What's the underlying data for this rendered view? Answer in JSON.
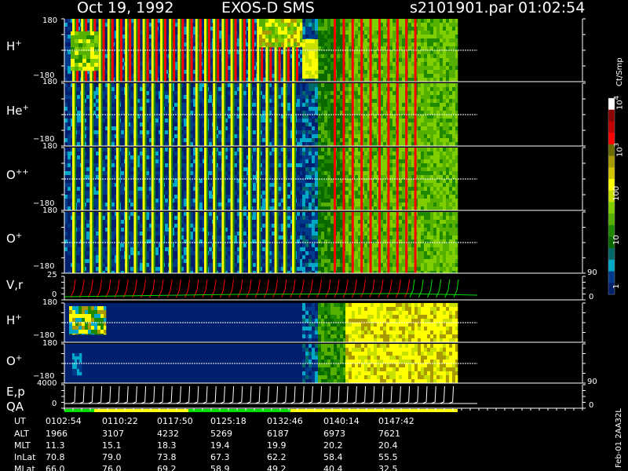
{
  "header": {
    "date": "Oct 19, 1992",
    "instrument": "EXOS-D SMS",
    "file": "s2101901.par",
    "time": "01:02:54"
  },
  "panels": [
    {
      "id": "hplus",
      "label": "H",
      "sup": "+",
      "top_tick": "180",
      "bottom_tick": "−180"
    },
    {
      "id": "heplus",
      "label": "He",
      "sup": "+",
      "top_tick": "180",
      "bottom_tick": "−180"
    },
    {
      "id": "oplusplus",
      "label": "O",
      "sup": "++",
      "top_tick": "180",
      "bottom_tick": "−180"
    },
    {
      "id": "oplus",
      "label": "O",
      "sup": "+",
      "top_tick": "180",
      "bottom_tick": "−180"
    },
    {
      "id": "vr",
      "label": "V,r",
      "sup": "",
      "top_tick": "25",
      "bottom_tick": "0",
      "right_top": "90",
      "right_bottom": "0"
    },
    {
      "id": "hplus2",
      "label": "H",
      "sup": "+",
      "top_tick": "180",
      "bottom_tick": "−180"
    },
    {
      "id": "oplus2",
      "label": "O",
      "sup": "+",
      "top_tick": "180",
      "bottom_tick": "−180",
      "right_bottom": "90"
    },
    {
      "id": "ep",
      "label": "E,p",
      "label2": "QA",
      "sup": "",
      "top_tick": "4000",
      "bottom_tick": "0",
      "right_bottom": "0"
    }
  ],
  "colorbar": {
    "unit": "Ct/Smp",
    "ticks": [
      {
        "base": "10",
        "exp": "4"
      },
      {
        "base": "10",
        "exp": "3"
      },
      {
        "base": "100",
        "exp": ""
      },
      {
        "base": "10",
        "exp": ""
      },
      {
        "base": "1",
        "exp": ""
      }
    ],
    "colors": [
      "#ffffff",
      "#8b0000",
      "#c00000",
      "#ff0000",
      "#6b6b00",
      "#a89a00",
      "#d4c400",
      "#ffff00",
      "#c8e000",
      "#7fcf00",
      "#55b000",
      "#1f8a00",
      "#0a6a00",
      "#006a6a",
      "#00a8c8",
      "#003a8a",
      "#00206e"
    ]
  },
  "footer": {
    "rows": [
      {
        "label": "UT",
        "values": [
          "0102:54",
          "0110:22",
          "0117:50",
          "0125:18",
          "0132:46",
          "0140:14",
          "0147:42"
        ]
      },
      {
        "label": "ALT",
        "values": [
          "1966",
          "3107",
          "4232",
          "5269",
          "6187",
          "6973",
          "7621"
        ]
      },
      {
        "label": "MLT",
        "values": [
          "11.3",
          "15.1",
          "18.3",
          "19.4",
          "19.9",
          "20.2",
          "20.4"
        ]
      },
      {
        "label": "InLat",
        "values": [
          "70.8",
          "79.0",
          "73.8",
          "67.3",
          "62.2",
          "58.4",
          "55.5"
        ]
      },
      {
        "label": "MLat",
        "values": [
          "66.0",
          "76.0",
          "69.2",
          "58.9",
          "49.2",
          "40.4",
          "32.5"
        ]
      }
    ],
    "side_note": "Feb-01 2AA32L"
  },
  "chart_data": {
    "type": "heatmap",
    "title": "Oct 19, 1992   EXOS-D SMS",
    "x_axis_label": "UT",
    "x_ticks": [
      "0102:54",
      "0110:22",
      "0117:50",
      "0125:18",
      "0132:46",
      "0140:14",
      "0147:42"
    ],
    "panels": [
      {
        "name": "H+",
        "y_range": [
          -180,
          180
        ]
      },
      {
        "name": "He+",
        "y_range": [
          -180,
          180
        ]
      },
      {
        "name": "O++",
        "y_range": [
          -180,
          180
        ]
      },
      {
        "name": "O+",
        "y_range": [
          -180,
          180
        ]
      },
      {
        "name": "V,r",
        "y_range": [
          0,
          25
        ],
        "right_range": [
          0,
          90
        ]
      },
      {
        "name": "H+",
        "y_range": [
          -180,
          180
        ]
      },
      {
        "name": "O+",
        "y_range": [
          -180,
          180
        ]
      },
      {
        "name": "E,p / QA",
        "y_range": [
          0,
          4000
        ]
      }
    ],
    "colorbar_unit": "Ct/Smp",
    "colorbar_range": [
      1,
      10000
    ],
    "colorbar_scale": "log"
  }
}
